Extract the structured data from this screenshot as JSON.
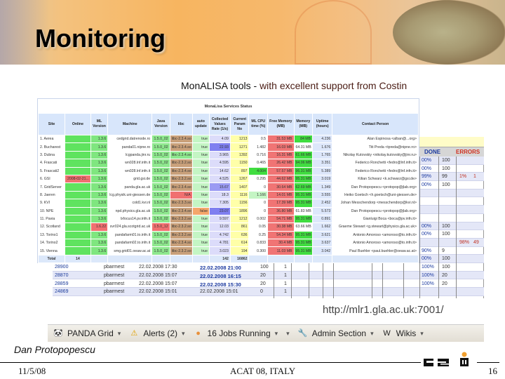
{
  "slide": {
    "title": "Monitoring",
    "subtitle_lead": "MonALISA tools -",
    "subtitle_rest": "with excellent support from Costin",
    "url": "http://mlr1.gla.ac.uk:7001/",
    "author": "Dan Protopopescu",
    "date": "11/5/08",
    "conference": "ACAT 08, ITALY",
    "page_number": "16",
    "logo_text": "GSI"
  },
  "monalisa": {
    "title": "MonaLisa Services Status",
    "columns": [
      "Site",
      "Online",
      "ML Version",
      "Machine",
      "Java Version",
      "libc",
      "auto update",
      "Collected Values Rate (1/s)",
      "Current Param No",
      "ML CPU time (%)",
      "Free Memory (MB)",
      "Memory (MB)",
      "Uptime (hours)",
      "Contact Person"
    ],
    "rows": [
      [
        "1. Aerea",
        "",
        "1.3.6",
        "cedgrid.datrenode.ro",
        "1.5.0_02",
        "libc-2.3.4.so",
        "true",
        "4.09",
        "1213",
        "0.5",
        "31.53 MB",
        "84 MB",
        "4.236",
        "Alan Espinosa <alban@...org>"
      ],
      [
        "2. Bucharest",
        "",
        "1.3.6",
        "panda01.nipne.ro",
        "1.5.0_02",
        "libc-2.3.4.so",
        "true",
        "22.93",
        "1271",
        "1.482",
        "16.03 MB",
        "64.31 MB",
        "1.676",
        "Titi Preda <tpreda@nipne.ro>"
      ],
      [
        "3. Dubna",
        "",
        "1.3.6",
        "lcgpanda.jinr.ru",
        "1.5.0_02",
        "libc-2.3.4.so",
        "true",
        "3.965",
        "1392",
        "0.716",
        "16.31 MB",
        "61.66 MB",
        "1.765",
        "Nikolay Kutovskiy <nikolay.kutovskiy@jinr.ru>"
      ],
      [
        "4. Frascati",
        "",
        "1.3.6",
        "wn028.lnf.infn.it",
        "1.5.0_02",
        "libc-2.3.2.so",
        "true",
        "4.595",
        "1150",
        "0.465",
        "26.42 MB",
        "94.06 MB",
        "3.351",
        "Federico Ronchetti <fedro@lnf.infn.it>"
      ],
      [
        "5. Frascati2",
        "",
        "1.3.6",
        "wn028.lnf.infn.it",
        "1.5.0_02",
        "libc-2.3.4.so",
        "true",
        "14.62",
        "897",
        "4.004",
        "57.57 MB",
        "96.31 MB",
        "5.389",
        "Federico Ronchetti <fedro@lnf.infn.it>"
      ],
      [
        "6. GSI",
        "2008-02-21...",
        "1.3.6",
        "grid.gsi.de",
        "1.5.0_02",
        "libc-2.3.2.so",
        "true",
        "4.525",
        "1267",
        "0.295",
        "44.62 MB",
        "95.31 MB",
        "3.019",
        "Kilian Schwarz <k.schwarz@gsi.de>"
      ],
      [
        "7. GridServer",
        "",
        "1.3.6",
        "panda.gla.ac.uk",
        "1.5.0_02",
        "libc-2.3.4.so",
        "true",
        "15.67",
        "1407",
        "0",
        "30.64 MB",
        "62.69 MB",
        "1.349",
        "Dan Protopopescu <protopop@jlab.org>"
      ],
      [
        "8. Jaeren",
        "",
        "1.3.6",
        "lcg.physik.uni-giessen.de",
        "1.5.0_02",
        "N/A",
        "true",
        "18.3",
        "1116",
        "1.166",
        "14.01 MB",
        "95.31 MB",
        "3.555",
        "Heiko Goetsch <h.goetsch@uni-giessen.de>"
      ],
      [
        "9. KVI",
        "",
        "1.3.6",
        "cold1.kvi.nl",
        "1.5.0_02",
        "libc-2.3.3.so",
        "true",
        "7.305",
        "1156",
        "0",
        "17.39 MB",
        "95.31 MB",
        "2.452",
        "Johan Messchendorp <messchendorp@kvi.nl>"
      ],
      [
        "10. NPE",
        "",
        "1.3.6",
        "npd.physics.gla.ac.uk",
        "1.5.0_02",
        "libc-2.3.4.so",
        "false",
        "23.07",
        "1896",
        "0",
        "36.80 MB",
        "61.83 MB",
        "5.573",
        "Dan Protopopescu <protopop@jlab.org>"
      ],
      [
        "11. Pavia",
        "",
        "1.3.6",
        "lxfocus14.pv.infn.it",
        "1.5.0_02",
        "libc-2.3.2.so",
        "true",
        "9.597",
        "1212",
        "0.002",
        "54.71 MB",
        "95.31 MB",
        "0.891",
        "Gianluigi Boca <boca@pv.infn.it>"
      ],
      [
        "12. Scotland",
        "",
        "1.6.22",
        "svr024.gla.scotgrid.ac.uk",
        "1.5.0_12",
        "libc-2.3.2.so",
        "true",
        "12.03",
        "861",
        "0.05",
        "30.38 MB",
        "63.66 MB",
        "1.662",
        "Graeme Stewart <g.stewart@physics.gla.ac.uk>"
      ],
      [
        "13. Torino1",
        "",
        "1.3.6",
        "pandafarm01.to.infn.it",
        "1.5.0_02",
        "libc-2.3.2.so",
        "true",
        "4.742",
        "636",
        "0.25",
        "54.34 MB",
        "95.31 MB",
        "3.621",
        "Antonio Amoroso <amoroso@to.infn.it>"
      ],
      [
        "14. Torino2",
        "",
        "1.3.6",
        "pandafarm02.to.infn.it",
        "1.5.0_02",
        "libc-2.3.4.so",
        "true",
        "4.781",
        "614",
        "0.833",
        "30.4 MB",
        "95.31 MB",
        "3.637",
        "Antonio Amoroso <amoroso@to.infn.it>"
      ],
      [
        "15. Vienna",
        "",
        "1.3.6",
        "smg.grid01.oeaw.ac.at",
        "1.5.0_02",
        "libc-2.3.2.so",
        "true",
        "3.023",
        "194",
        "0.300",
        "11.03 MB",
        "95.31 MB",
        "3.042",
        "Paul Buehler <paul.buehler@oeaw.ac.at>"
      ]
    ],
    "total": [
      "Total",
      "14",
      "",
      "",
      "",
      "",
      "",
      "142",
      "16862",
      "",
      "",
      "",
      "",
      ""
    ],
    "column_colors": [
      "#ffffff",
      "#5fe35f",
      "#7fe67f",
      "#ffffff",
      "#8ee88e",
      "#c9a07a",
      "#c4f5c4",
      "#dcdcfa",
      "#ffffa8",
      "#ffffff",
      "#f07474",
      "#40dd40",
      "#dde7fb",
      "#ffffff"
    ],
    "cell_overrides": [
      {
        "row": 1,
        "col": 7,
        "color": "#7f7ff0"
      },
      {
        "row": 2,
        "col": 5,
        "color": "#8ee88e"
      },
      {
        "row": 4,
        "col": 9,
        "color": "#40dd40"
      },
      {
        "row": 5,
        "col": 1,
        "color": "#f07070"
      },
      {
        "row": 6,
        "col": 7,
        "color": "#9b9bf3"
      },
      {
        "row": 7,
        "col": 5,
        "color": "#f07070"
      },
      {
        "row": 7,
        "col": 9,
        "color": "#c4f5c4"
      },
      {
        "row": 9,
        "col": 6,
        "color": "#f4a66a"
      },
      {
        "row": 9,
        "col": 7,
        "color": "#7f7ff0"
      },
      {
        "row": 11,
        "col": 2,
        "color": "#f07070"
      },
      {
        "row": 11,
        "col": 4,
        "color": "#f07070"
      },
      {
        "row": 9,
        "col": 11,
        "color": "#ffffff"
      },
      {
        "row": 1,
        "col": 11,
        "color": "#ffffff"
      },
      {
        "row": 11,
        "col": 11,
        "color": "#ffffff"
      }
    ]
  },
  "jobs": {
    "done_label": "DONE",
    "errors_label": "ERRORS",
    "rows": [
      {
        "done_pct": "00%",
        "done": "100"
      },
      {
        "done_pct": "00%",
        "done": "100"
      },
      {
        "done_pct": "99%",
        "done": "99",
        "err_pct": "1%",
        "err": "1"
      },
      {
        "done_pct": "00%",
        "done": "100"
      },
      {},
      {},
      {},
      {},
      {
        "done_pct": "00%",
        "done": "100"
      },
      {
        "done_pct": "00%",
        "done": "100"
      },
      {
        "err_pct": "98%",
        "err": "49"
      },
      {
        "done_pct": "90%",
        "done": "9"
      },
      {
        "done_pct": "00%",
        "done": "100"
      },
      {
        "id": "28900",
        "user": "pbarmest",
        "start": "22.02.2008 17:30",
        "end": "22.02.2008 21:00",
        "end_bold": true,
        "count": "100",
        "n": "1",
        "done_pct": "100%",
        "done": "100"
      },
      {
        "id": "28870",
        "user": "pbarmest",
        "start": "22.02.2008 15:07",
        "end": "22.02.2008 16:15",
        "end_bold": true,
        "count": "20",
        "n": "1",
        "done_pct": "100%",
        "done": "20"
      },
      {
        "id": "28859",
        "user": "pbarmest",
        "start": "22.02.2008 15:07",
        "end": "22.02.2008 15:30",
        "end_bold": true,
        "count": "20",
        "n": "1",
        "done_pct": "100%",
        "done": "20"
      },
      {
        "id": "24869",
        "user": "pbarmest",
        "start": "22.02.2008 15:01",
        "end": "22.02.2008 15:01",
        "end_bold": false,
        "count": "0",
        "n": "1"
      }
    ]
  },
  "toolbar": {
    "items": [
      {
        "label": "PANDA Grid",
        "icon": "panda-icon"
      },
      {
        "label": "Alerts (2)",
        "icon": "warning-icon"
      },
      {
        "label": "16 Jobs Running",
        "icon": "jobs-icon"
      },
      {
        "label": "",
        "icon": ""
      },
      {
        "label": "Admin Section",
        "icon": "wrench-icon"
      },
      {
        "label": "Wikis",
        "icon": "wikipedia-icon"
      }
    ]
  }
}
